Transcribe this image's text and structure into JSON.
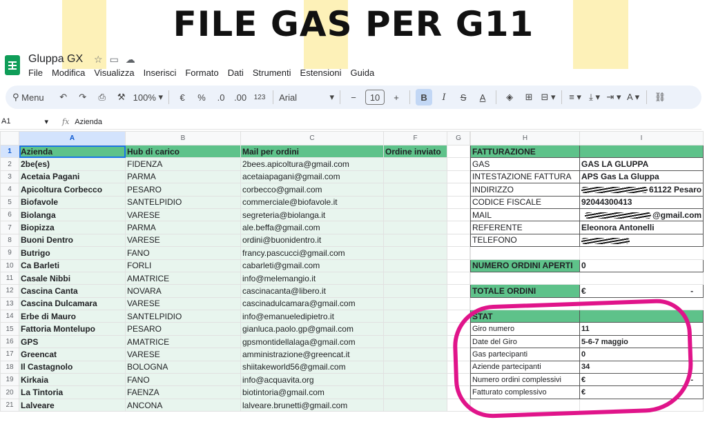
{
  "headline": "FILE GAS PER G11",
  "app": {
    "doc_name": "Gluppa GX",
    "menu": [
      "File",
      "Modifica",
      "Visualizza",
      "Inserisci",
      "Formato",
      "Dati",
      "Strumenti",
      "Estensioni",
      "Guida"
    ]
  },
  "toolbar": {
    "menu_label": "Menu",
    "zoom": "100%",
    "currency": "€",
    "percent": "%",
    "dec_decrease": ".0",
    "dec_increase": ".00",
    "number_format": "123",
    "font": "Arial",
    "font_size": "10",
    "bold": "B",
    "italic": "I",
    "strike": "S",
    "text_color": "A",
    "minus": "−",
    "plus": "+"
  },
  "formula_bar": {
    "cell": "A1",
    "fx": "fx",
    "content": "Azienda"
  },
  "columns": [
    "A",
    "B",
    "C",
    "F",
    "G",
    "H",
    "I"
  ],
  "table": {
    "headers": [
      "Azienda",
      "Hub di carico",
      "Mail per ordini",
      "Ordine inviato"
    ],
    "rows": [
      [
        "2be(es)",
        "FIDENZA",
        "2bees.apicoltura@gmail.com"
      ],
      [
        "Acetaia Pagani",
        "PARMA",
        "acetaiapagani@gmail.com"
      ],
      [
        "Apicoltura Corbecco",
        "PESARO",
        "corbecco@gmail.com"
      ],
      [
        "Biofavole",
        "SANTELPIDIO",
        "commerciale@biofavole.it"
      ],
      [
        "Biolanga",
        "VARESE",
        "segreteria@biolanga.it"
      ],
      [
        "Biopizza",
        "PARMA",
        "ale.beffa@gmail.com"
      ],
      [
        "Buoni Dentro",
        "VARESE",
        "ordini@buonidentro.it"
      ],
      [
        "Butrigo",
        "FANO",
        "francy.pascucci@gmail.com"
      ],
      [
        "Ca Barleti",
        "FORLI",
        "cabarleti@gmail.com"
      ],
      [
        "Casale Nibbi",
        "AMATRICE",
        "info@melemangio.it"
      ],
      [
        "Cascina Canta",
        "NOVARA",
        "cascinacanta@libero.it"
      ],
      [
        "Cascina Dulcamara",
        "VARESE",
        "cascinadulcamara@gmail.com"
      ],
      [
        "Erbe di Mauro",
        "SANTELPIDIO",
        "info@emanueledipietro.it"
      ],
      [
        "Fattoria Montelupo",
        "PESARO",
        "gianluca.paolo.gp@gmail.com"
      ],
      [
        "GPS",
        "AMATRICE",
        "gpsmontidellalaga@gmail.com"
      ],
      [
        "Greencat",
        "VARESE",
        "amministrazione@greencat.it"
      ],
      [
        "Il Castagnolo",
        "BOLOGNA",
        "shiitakeworld56@gmail.com"
      ],
      [
        "Kirkaia",
        "FANO",
        "info@acquavita.org"
      ],
      [
        "La Tintoria",
        "FAENZA",
        "biotintoria@gmail.com"
      ],
      [
        "Lalveare",
        "ANCONA",
        "lalveare.brunetti@gmail.com"
      ]
    ]
  },
  "fatturazione": {
    "title": "FATTURAZIONE",
    "rows": [
      {
        "label": "GAS",
        "value": "GAS LA GLUPPA"
      },
      {
        "label": "INTESTAZIONE FATTURA",
        "value": "APS Gas La Gluppa"
      },
      {
        "label": "INDIRIZZO",
        "value": "61122 Pesaro"
      },
      {
        "label": "CODICE FISCALE",
        "value": "92044300413"
      },
      {
        "label": "MAIL",
        "value": "@gmail.com"
      },
      {
        "label": "REFERENTE",
        "value": "Eleonora Antonelli"
      },
      {
        "label": "TELEFONO",
        "value": ""
      }
    ]
  },
  "numero_ordini": {
    "label": "NUMERO ORDINI APERTI",
    "value": "0"
  },
  "totale_ordini": {
    "label": "TOTALE ORDINI",
    "value": "€",
    "suffix": "-"
  },
  "stat": {
    "title": "STAT",
    "rows": [
      {
        "label": "Giro numero",
        "value": "11",
        "suffix": ""
      },
      {
        "label": "Date del Giro",
        "value": "5-6-7 maggio",
        "suffix": ""
      },
      {
        "label": "Gas partecipanti",
        "value": "0",
        "suffix": ""
      },
      {
        "label": "Aziende partecipanti",
        "value": "34",
        "suffix": ""
      },
      {
        "label": "Numero ordini complessivi",
        "value": "€",
        "suffix": "-"
      },
      {
        "label": "Fatturato complessivo",
        "value": "€",
        "suffix": ""
      }
    ]
  },
  "colors": {
    "header_green": "#5ec28a",
    "row_tint": "#e8f5ee",
    "annotation": "#e0148a"
  }
}
